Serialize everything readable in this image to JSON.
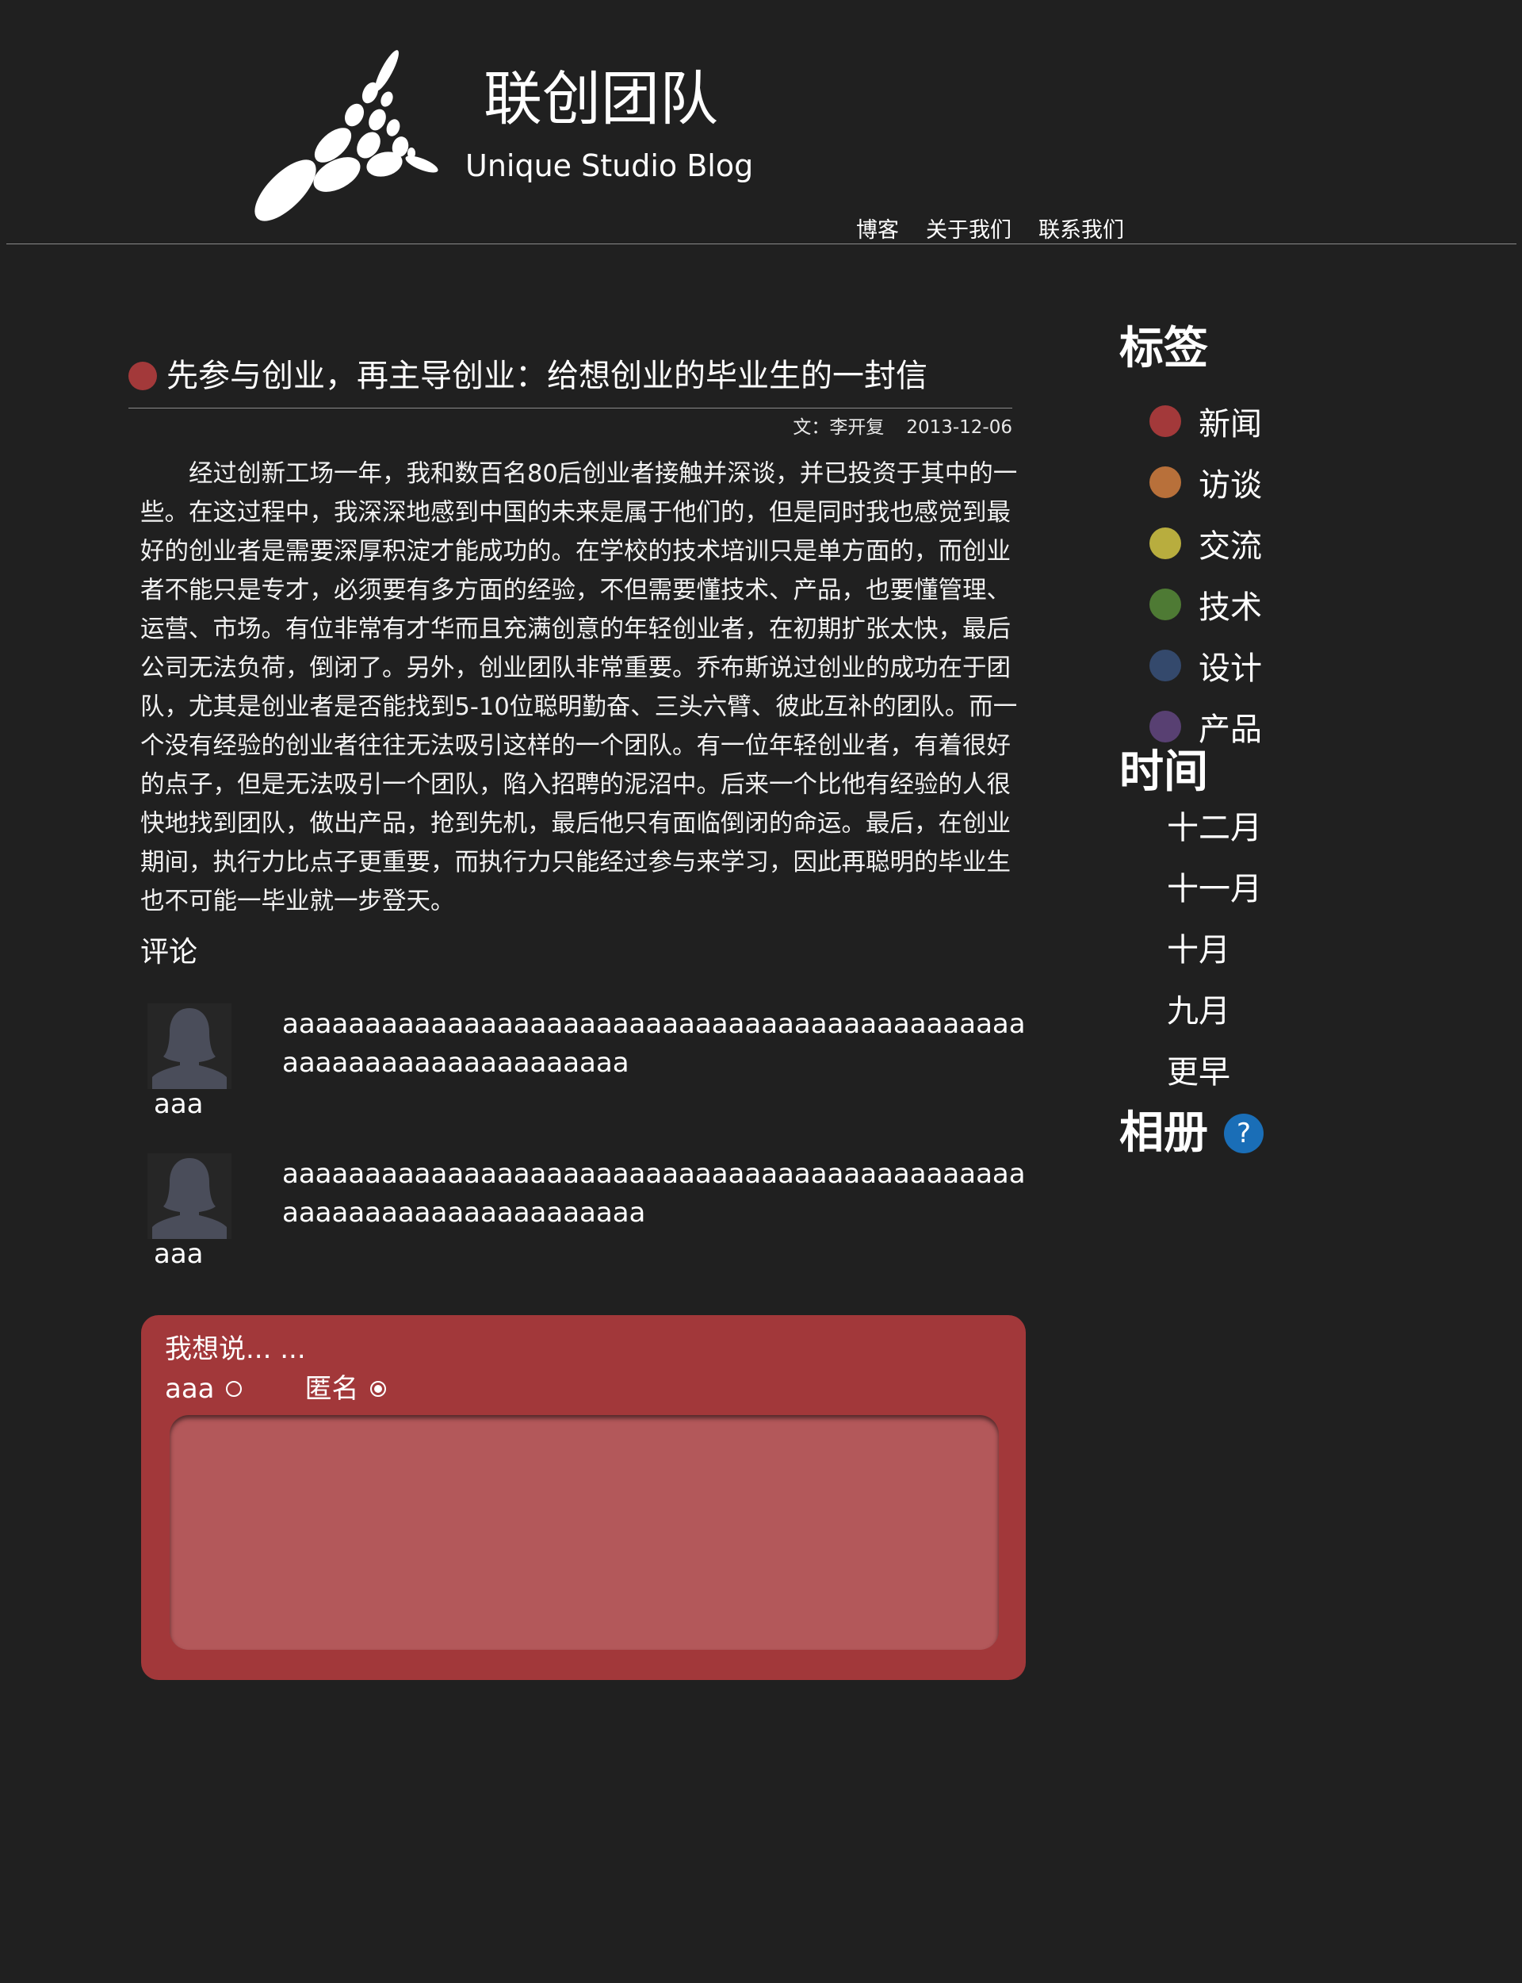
{
  "header": {
    "logo_icon": "unique-studio-dots-logo",
    "title": "联创团队",
    "subtitle": "Unique Studio Blog",
    "nav": [
      "博客",
      "关于我们",
      "联系我们"
    ]
  },
  "article": {
    "title": "先参与创业，再主导创业：给想创业的毕业生的一封信",
    "title_dot_color": "#a3393a",
    "author": "文：李开复",
    "date": "2013-12-06",
    "body": "经过创新工场一年，我和数百名80后创业者接触并深谈，并已投资于其中的一些。在这过程中，我深深地感到中国的未来是属于他们的，但是同时我也感觉到最好的创业者是需要深厚积淀才能成功的。在学校的技术培训只是单方面的，而创业者不能只是专才，必须要有多方面的经验，不但需要懂技术、产品，也要懂管理、运营、市场。有位非常有才华而且充满创意的年轻创业者，在初期扩张太快，最后公司无法负荷，倒闭了。另外，创业团队非常重要。乔布斯说过创业的成功在于团队，尤其是创业者是否能找到5-10位聪明勤奋、三头六臂、彼此互补的团队。而一个没有经验的创业者往往无法吸引这样的一个团队。有一位年轻创业者，有着很好的点子，但是无法吸引一个团队，陷入招聘的泥沼中。后来一个比他有经验的人很快地找到团队，做出产品，抢到先机，最后他只有面临倒闭的命运。最后，在创业期间，执行力比点子更重要，而执行力只能经过参与来学习，因此再聪明的毕业生也不可能一毕业就一步登天。"
  },
  "comments": {
    "heading": "评论",
    "items": [
      {
        "name": "aaa",
        "avatar_icon": "user-silhouette-icon",
        "text": "aaaaaaaaaaaaaaaaaaaaaaaaaaaaaaaaaaaaaaaaaaaaaaaaaaaaaaaaaaaaaaaaaa"
      },
      {
        "name": "aaa",
        "avatar_icon": "user-silhouette-icon",
        "text": "aaaaaaaaaaaaaaaaaaaaaaaaaaaaaaaaaaaaaaaaaaaaaaaaaaaaaaaaaaaaaaaaaaa"
      }
    ]
  },
  "comment_form": {
    "prompt": "我想说... ...",
    "identity_options": [
      {
        "label": "aaa",
        "selected": false
      },
      {
        "label": "匿名",
        "selected": true
      }
    ],
    "input_value": "",
    "background_color": "#a2383a"
  },
  "sidebar": {
    "tags_heading": "标签",
    "tags": [
      {
        "label": "新闻",
        "color": "#a3393a"
      },
      {
        "label": "访谈",
        "color": "#b8703a"
      },
      {
        "label": "交流",
        "color": "#b8ad3e"
      },
      {
        "label": "技术",
        "color": "#4e7a34"
      },
      {
        "label": "设计",
        "color": "#34496c"
      },
      {
        "label": "产品",
        "color": "#584072"
      }
    ],
    "time_heading": "时间",
    "months": [
      "十二月",
      "十一月",
      "十月",
      "九月",
      "更早"
    ],
    "album_heading": "相册",
    "album_help_icon": "question-mark-icon",
    "album_help_text": "?"
  }
}
